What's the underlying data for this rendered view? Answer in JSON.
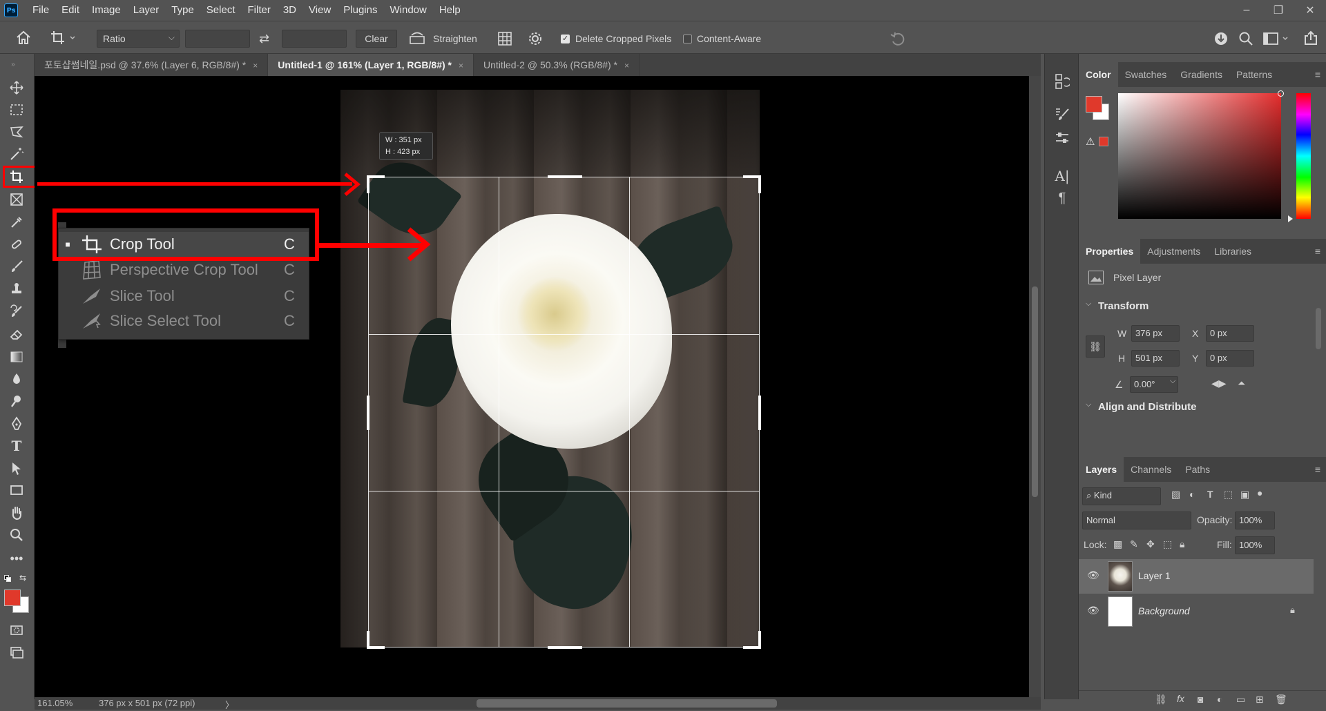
{
  "app": {
    "logo": "Ps"
  },
  "menu": [
    "File",
    "Edit",
    "Image",
    "Layer",
    "Type",
    "Select",
    "Filter",
    "3D",
    "View",
    "Plugins",
    "Window",
    "Help"
  ],
  "window_controls": {
    "minimize": "–",
    "restore": "❐",
    "close": "✕"
  },
  "options": {
    "ratio_select": "Ratio",
    "swap_icon": "⇄",
    "clear_label": "Clear",
    "straighten_label": "Straighten",
    "delete_cropped_label": "Delete Cropped Pixels",
    "delete_cropped_checked": true,
    "content_aware_label": "Content-Aware",
    "content_aware_checked": false
  },
  "tabs": [
    {
      "label": "포토샵썸네일.psd @ 37.6% (Layer 6, RGB/8#) *",
      "close": "×",
      "active": false
    },
    {
      "label": "Untitled-1 @ 161% (Layer 1, RGB/8#) *",
      "close": "×",
      "active": true
    },
    {
      "label": "Untitled-2 @ 50.3% (RGB/8#) *",
      "close": "×",
      "active": false
    }
  ],
  "crop_tooltip": {
    "w": "W : 351 px",
    "h": "H : 423 px"
  },
  "flyout": {
    "items": [
      {
        "label": "Crop Tool",
        "key": "C",
        "selected": true,
        "icon": "crop-icon"
      },
      {
        "label": "Perspective Crop Tool",
        "key": "C",
        "selected": false,
        "icon": "perspective-crop-icon"
      },
      {
        "label": "Slice Tool",
        "key": "C",
        "selected": false,
        "icon": "slice-icon"
      },
      {
        "label": "Slice Select Tool",
        "key": "C",
        "selected": false,
        "icon": "slice-select-icon"
      }
    ],
    "bullet": "■"
  },
  "color_panel": {
    "tabs": [
      "Color",
      "Swatches",
      "Gradients",
      "Patterns"
    ],
    "foreground": "#e0392b",
    "background": "#ffffff",
    "warning": "⚠"
  },
  "properties_panel": {
    "tabs": [
      "Properties",
      "Adjustments",
      "Libraries"
    ],
    "type_label": "Pixel Layer",
    "transform_title": "Transform",
    "w_label": "W",
    "w_value": "376 px",
    "h_label": "H",
    "h_value": "501 px",
    "x_label": "X",
    "x_value": "0 px",
    "y_label": "Y",
    "y_value": "0 px",
    "angle_value": "0.00°",
    "align_title": "Align and Distribute"
  },
  "layers_panel": {
    "tabs": [
      "Layers",
      "Channels",
      "Paths"
    ],
    "kind_label": "Kind",
    "blend_mode": "Normal",
    "opacity_label": "Opacity:",
    "opacity_value": "100%",
    "lock_label": "Lock:",
    "fill_label": "Fill:",
    "fill_value": "100%",
    "layers": [
      {
        "name": "Layer 1",
        "selected": true
      },
      {
        "name": "Background",
        "selected": false,
        "locked": true
      }
    ]
  },
  "status": {
    "zoom": "161.05%",
    "doc_info": "376 px x 501 px (72 ppi)",
    "arrow": "〉"
  },
  "accent_colors": {
    "annotation_red": "#ff0000",
    "foreground_swatch": "#e0392b"
  }
}
